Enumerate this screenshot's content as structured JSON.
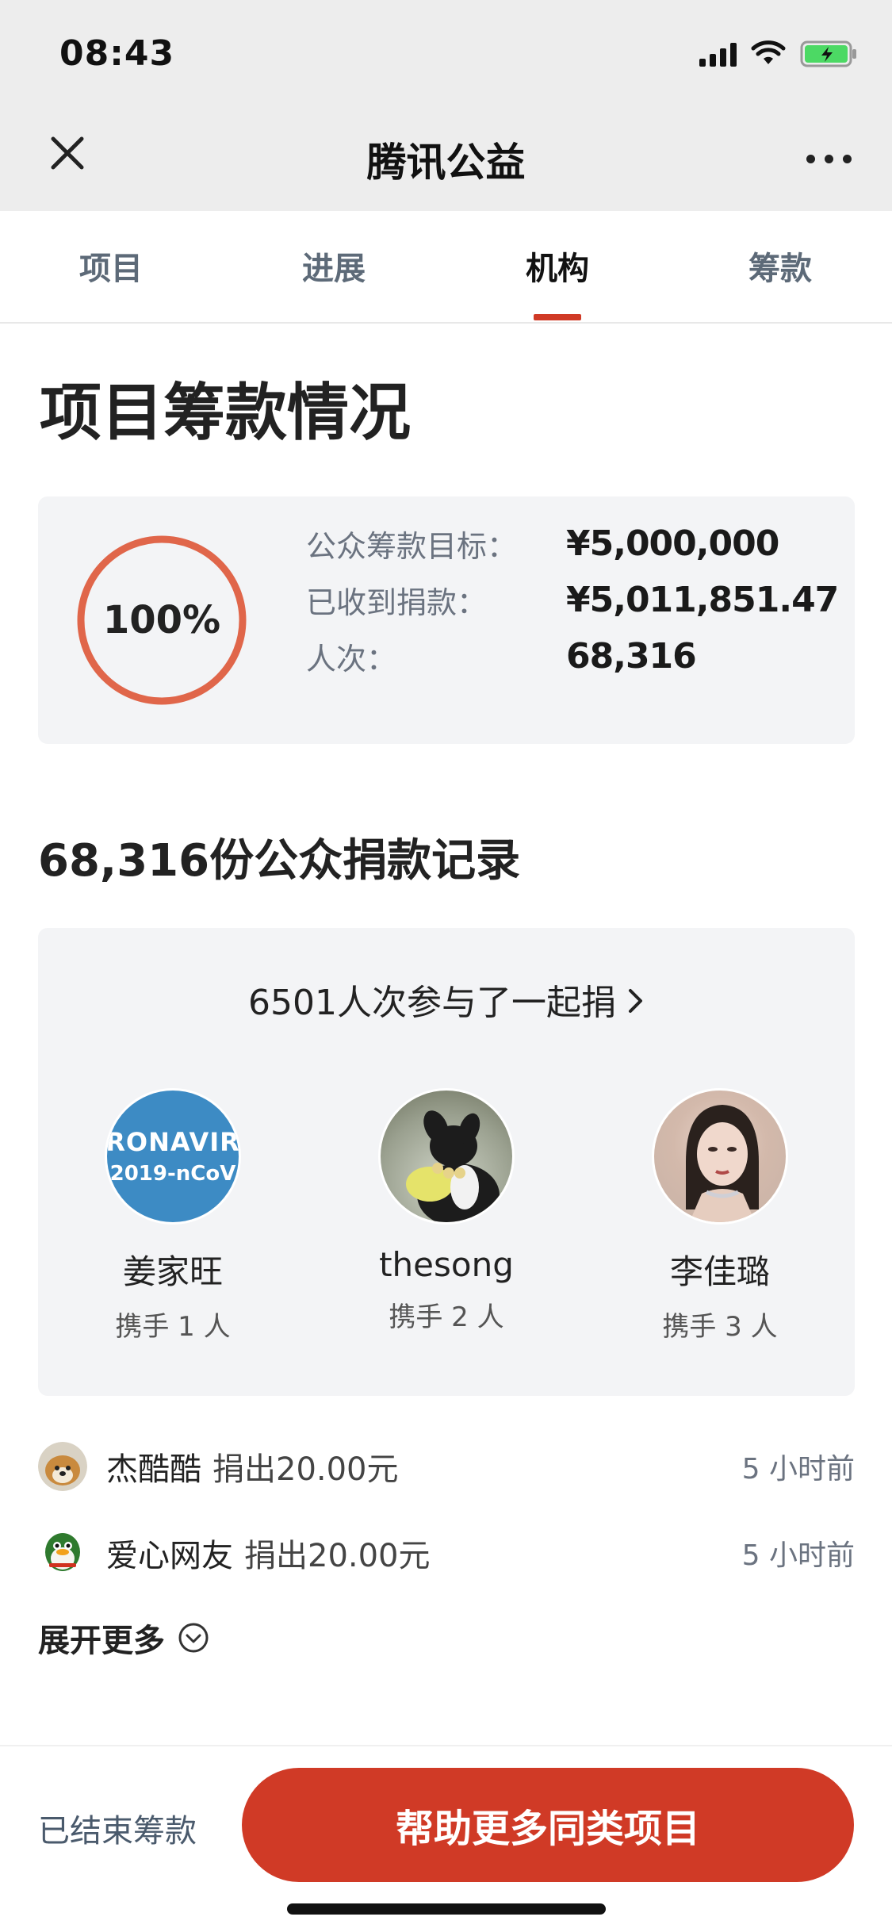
{
  "status_bar": {
    "time": "08:43"
  },
  "nav": {
    "title": "腾讯公益"
  },
  "tabs": [
    {
      "label": "项目",
      "active": false
    },
    {
      "label": "进展",
      "active": false
    },
    {
      "label": "机构",
      "active": true
    },
    {
      "label": "筹款",
      "active": false
    }
  ],
  "summary": {
    "title": "项目筹款情况",
    "progress_label": "100%",
    "progress_fraction": 1.0,
    "stats": [
      {
        "label": "公众筹款目标：",
        "value": "¥5,000,000"
      },
      {
        "label": "已收到捐款：",
        "value": "¥5,011,851.47"
      },
      {
        "label": "人次：",
        "value": "68,316"
      }
    ]
  },
  "records": {
    "title": "68,316份公众捐款记录",
    "team_link": "6501人次参与了一起捐",
    "members": [
      {
        "name": "姜家旺",
        "sub": "携手 1 人",
        "avatar_text1": "RONAVIR",
        "avatar_text2": "2019-nCoV"
      },
      {
        "name": "thesong",
        "sub": "携手 2 人"
      },
      {
        "name": "李佳璐",
        "sub": "携手 3 人"
      }
    ],
    "donations": [
      {
        "name": "杰酷酷",
        "amount": "捐出20.00元",
        "time": "5 小时前"
      },
      {
        "name": "爱心网友",
        "amount": "捐出20.00元",
        "time": "5 小时前"
      }
    ],
    "expand_label": "展开更多"
  },
  "bottom": {
    "ended_label": "已结束筹款",
    "cta_label": "帮助更多同类项目"
  },
  "colors": {
    "accent": "#d03a26",
    "ring": "#e0664a",
    "card_bg": "#f3f4f6"
  }
}
